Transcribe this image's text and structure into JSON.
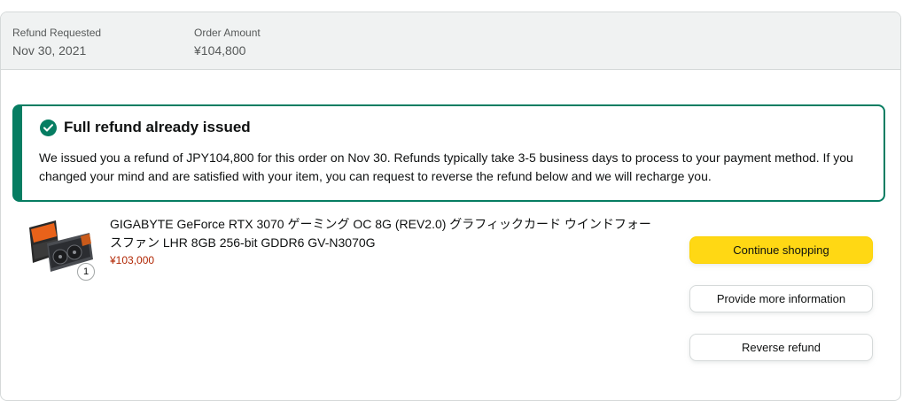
{
  "order": {
    "refund_label": "Refund Requested",
    "refund_date": "Nov 30, 2021",
    "amount_label": "Order Amount",
    "amount_value": "¥104,800"
  },
  "alert": {
    "title": "Full refund already issued",
    "body": "We issued you a refund of JPY104,800 for this order on Nov 30. Refunds typically take 3-5 business days to process to your payment method. If you changed your mind and are satisfied with your item, you can request to reverse the refund below and we will recharge you.",
    "icon": "check-circle-icon",
    "accent_color": "#067d62"
  },
  "item": {
    "title": "GIGABYTE GeForce RTX 3070 ゲーミング OC 8G (REV2.0) グラフィックカード ウインドフォースファン LHR 8GB 256-bit GDDR6 GV-N3070G",
    "price": "¥103,000",
    "quantity": "1",
    "image_icon": "graphics-card-image"
  },
  "actions": {
    "continue_shopping": "Continue shopping",
    "provide_info": "Provide more information",
    "reverse_refund": "Reverse refund"
  },
  "colors": {
    "primary_button": "#ffd814",
    "price": "#b12704",
    "header_bg": "#f0f2f2"
  }
}
